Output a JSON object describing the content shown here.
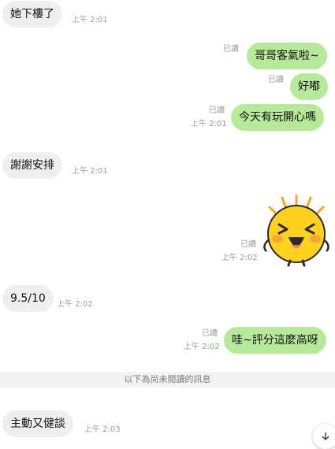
{
  "messages": [
    {
      "id": "m1",
      "side": "in",
      "text": "她下樓了",
      "time": "上午 2:01"
    },
    {
      "id": "m2",
      "side": "out",
      "text": "哥哥客氣啦~",
      "read": "已讀"
    },
    {
      "id": "m3",
      "side": "out",
      "text": "好嘟",
      "read": "已讀"
    },
    {
      "id": "m4",
      "side": "out",
      "text": "今天有玩開心嗎",
      "read": "已讀",
      "time": "上午 2:01"
    },
    {
      "id": "m5",
      "side": "in",
      "text": "謝謝安排",
      "time": "上午 2:01"
    },
    {
      "id": "m6",
      "side": "out",
      "sticker": "laughing-sun-sticker",
      "read": "已讀",
      "time": "上午 2:02"
    },
    {
      "id": "m7",
      "side": "in",
      "text": "9.5/10",
      "time": "上午 2:02"
    },
    {
      "id": "m8",
      "side": "out",
      "text": "哇~評分這麼高呀",
      "read": "已讀",
      "time": "上午 2:02"
    },
    {
      "id": "m9",
      "side": "in",
      "text": "主動又健談",
      "time": "上午 2:03"
    }
  ],
  "divider": "以下為尚未閱讀的訊息",
  "scroll_button_icon": "arrow-down-icon",
  "colors": {
    "incoming_bubble": "#efefef",
    "outgoing_bubble": "#b6e99a",
    "meta_text": "#9a9a9a"
  }
}
